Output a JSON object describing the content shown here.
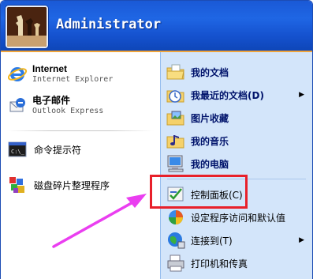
{
  "user": {
    "name": "Administrator"
  },
  "pinned": [
    {
      "title": "Internet",
      "subtitle": "Internet Explorer",
      "icon": "internet-explorer-icon"
    },
    {
      "title": "电子邮件",
      "subtitle": "Outlook Express",
      "icon": "outlook-express-icon"
    }
  ],
  "recent": [
    {
      "label": "命令提示符",
      "icon": "command-prompt-icon"
    },
    {
      "label": "磁盘碎片整理程序",
      "icon": "disk-defragmenter-icon"
    }
  ],
  "places": [
    {
      "label": "我的文档",
      "icon": "my-documents-icon"
    },
    {
      "label": "我最近的文档(D)",
      "icon": "recent-documents-icon",
      "submenu": true
    },
    {
      "label": "图片收藏",
      "icon": "my-pictures-icon"
    },
    {
      "label": "我的音乐",
      "icon": "my-music-icon"
    },
    {
      "label": "我的电脑",
      "icon": "my-computer-icon"
    },
    {
      "label": "控制面板(C)",
      "icon": "control-panel-icon"
    },
    {
      "label": "设定程序访问和默认值",
      "icon": "program-access-icon"
    },
    {
      "label": "连接到(T)",
      "icon": "connect-to-icon",
      "submenu": true
    },
    {
      "label": "打印机和传真",
      "icon": "printers-faxes-icon"
    }
  ],
  "colors": {
    "header": "#1f66e4",
    "accent": "#f0a43a",
    "highlight": "#e8202a",
    "arrow": "#ea3ef0",
    "right_panel": "#d3e5fa"
  }
}
